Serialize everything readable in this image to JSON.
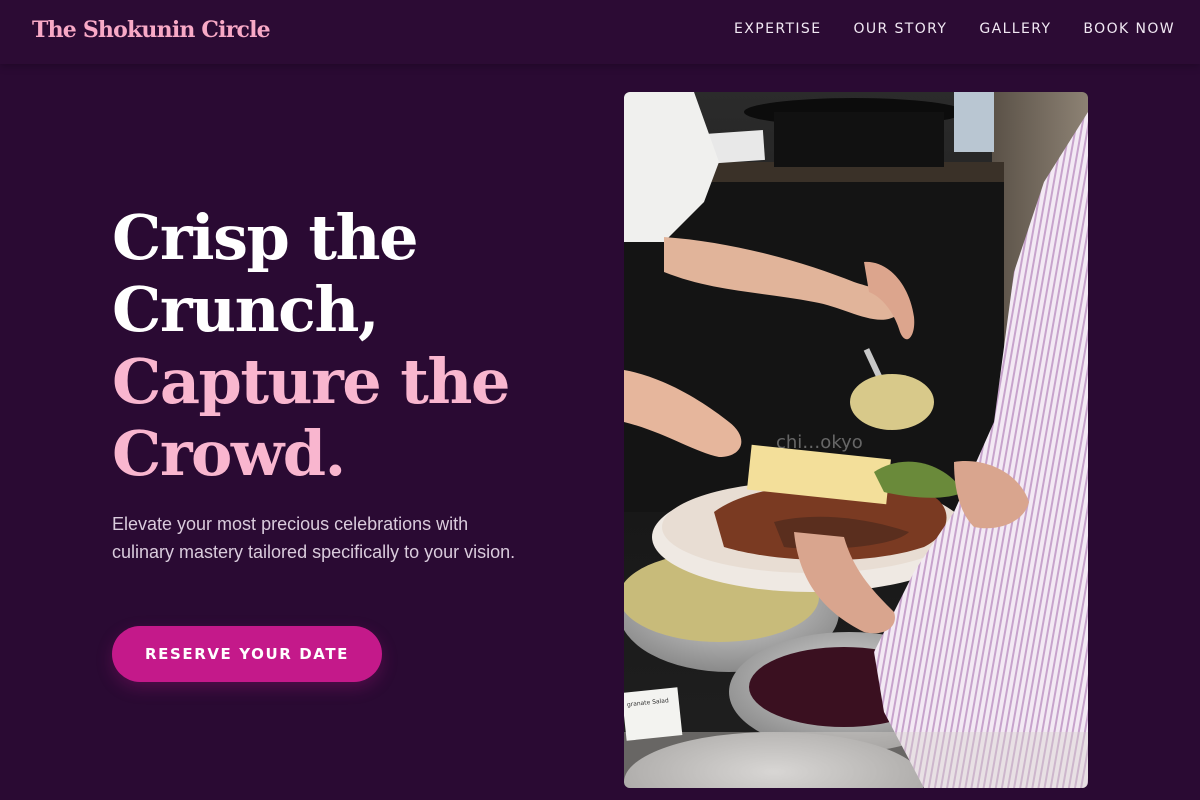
{
  "brand": {
    "name": "The Shokunin Circle"
  },
  "nav": {
    "items": [
      {
        "label": "EXPERTISE"
      },
      {
        "label": "OUR STORY"
      },
      {
        "label": "GALLERY"
      },
      {
        "label": "BOOK NOW"
      }
    ]
  },
  "hero": {
    "title_lines": [
      {
        "text": "Crisp the",
        "color": "#ffffff"
      },
      {
        "text": "Crunch,",
        "color": "#ffffff"
      },
      {
        "text": "Capture the",
        "color": "#f9b6cf"
      },
      {
        "text": "Crowd.",
        "color": "#f9b6cf"
      }
    ],
    "subtitle": "Elevate your most precious celebrations with culinary mastery tailored specifically to your vision.",
    "cta_label": "RESERVE YOUR DATE",
    "image": {
      "watermark": "chi…okyo",
      "label_text": "granate Salad"
    }
  },
  "colors": {
    "background": "#2a0a33",
    "brand": "#f8a9c6",
    "accent": "#c4198a"
  }
}
